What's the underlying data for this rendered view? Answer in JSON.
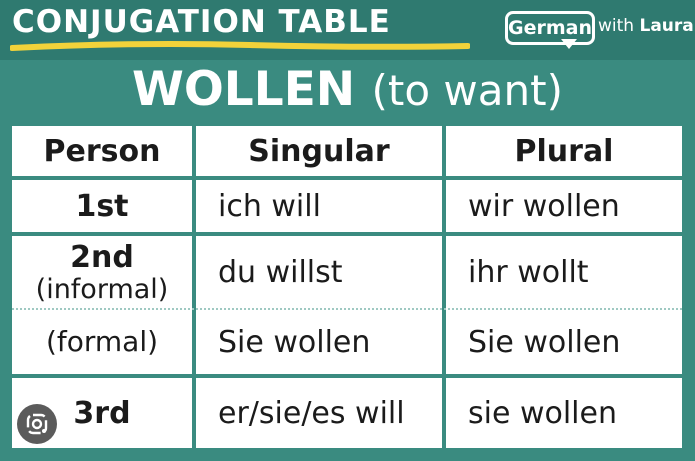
{
  "header": {
    "title": "CONJUGATION TABLE",
    "brand_main": "German",
    "brand_with": "with",
    "brand_name": "Laura"
  },
  "verb": {
    "word": "WOLLEN",
    "meaning": "(to want)"
  },
  "table": {
    "headers": [
      "Person",
      "Singular",
      "Plural"
    ],
    "rows": [
      {
        "person": "1st",
        "person_sub": "",
        "singular": "ich will",
        "plural": "wir wollen"
      },
      {
        "person": "2nd",
        "person_sub": "(informal)",
        "singular": "du willst",
        "plural": "ihr wollt"
      },
      {
        "person": "",
        "person_sub": "(formal)",
        "singular": "Sie wollen",
        "plural": "Sie wollen"
      },
      {
        "person": "3rd",
        "person_sub": "",
        "singular": "er/sie/es will",
        "plural": "sie wollen"
      }
    ]
  },
  "colors": {
    "background": "#3a8b80",
    "underline": "#f2d23a",
    "text": "#1b1b1b"
  },
  "icons": {
    "lens": "google-lens-icon"
  }
}
